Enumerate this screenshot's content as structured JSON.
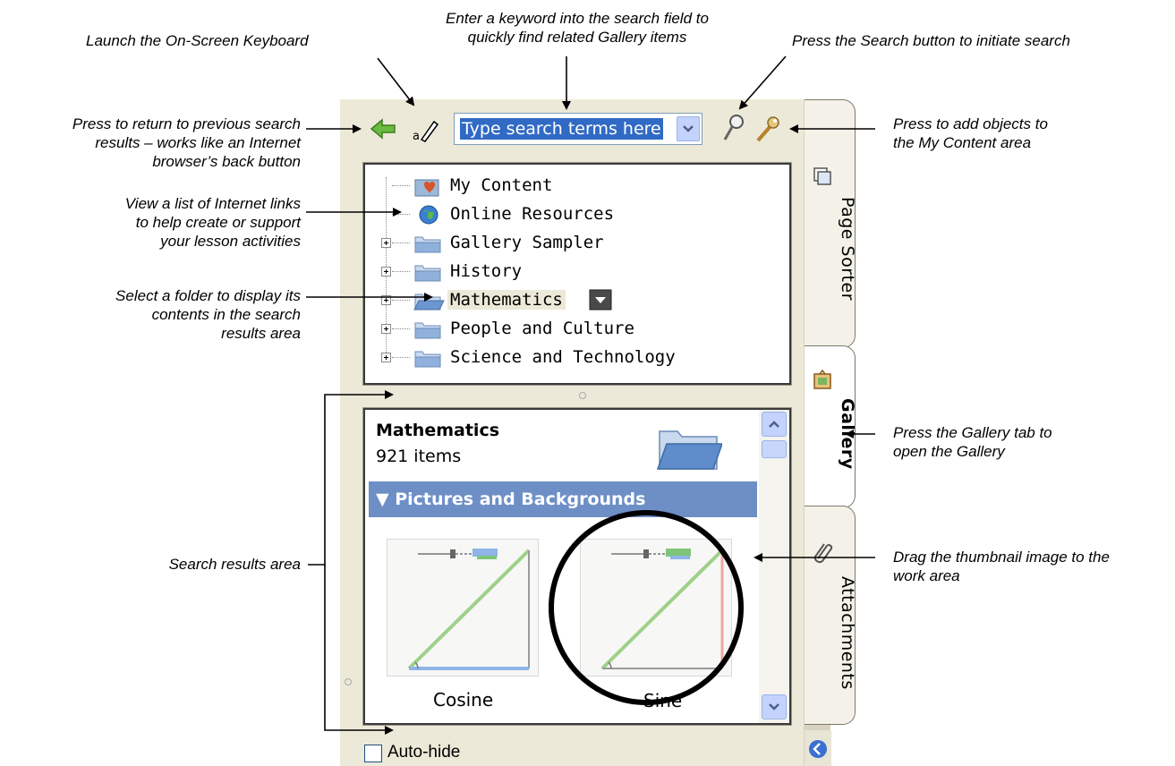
{
  "callouts": {
    "keyword": [
      "Enter a keyword into the search field to",
      "quickly find related Gallery items"
    ],
    "keyboard": "Launch the On-Screen Keyboard",
    "search_button": "Press the Search button to initiate search",
    "back": [
      "Press to return to previous search",
      "results – works like an Internet",
      "browser’s back button"
    ],
    "add_objects": [
      "Press to add objects to",
      "the My Content area"
    ],
    "internet_links": [
      "View a list of Internet links",
      "to help create or support",
      "your lesson activities"
    ],
    "select_folder": [
      "Select a folder to display its",
      "contents in the search",
      "results area"
    ],
    "gallery_tab": [
      "Press the Gallery tab to",
      "open the Gallery"
    ],
    "results_area": "Search results area",
    "drag_thumbnail": [
      "Drag the thumbnail image to the",
      "work area"
    ]
  },
  "toolbar": {
    "back_icon": "green-left-arrow-icon",
    "keyboard_icon": "keyboard-pen-icon",
    "search_placeholder": "Type search terms here",
    "search_icon": "magnifier-icon",
    "add_icon": "wrench-icon"
  },
  "tree": {
    "items": [
      {
        "label": "My Content",
        "icon": "my-content-folder-icon",
        "expandable": false
      },
      {
        "label": "Online Resources",
        "icon": "globe-icon",
        "expandable": false
      },
      {
        "label": "Gallery Sampler",
        "icon": "folder-icon",
        "expandable": true
      },
      {
        "label": "History",
        "icon": "folder-icon",
        "expandable": true
      },
      {
        "label": "Mathematics",
        "icon": "open-folder-icon",
        "expandable": true,
        "selected": true
      },
      {
        "label": "People and Culture",
        "icon": "folder-icon",
        "expandable": true
      },
      {
        "label": "Science and Technology",
        "icon": "folder-icon",
        "expandable": true
      }
    ]
  },
  "results": {
    "folder_title": "Mathematics",
    "item_count": "921 items",
    "section_title": "▼ Pictures and Backgrounds",
    "thumbnails": [
      {
        "label": "Cosine"
      },
      {
        "label": "Sine"
      }
    ]
  },
  "side_tabs": {
    "page_sorter": "Page Sorter",
    "gallery": "Gallery",
    "attachments": "Attachments"
  },
  "autohide": {
    "label": "Auto-hide",
    "checked": false
  },
  "colors": {
    "panel_bg": "#ece9d8",
    "selection_blue": "#316ac5",
    "section_bar": "#6d8fc6"
  }
}
